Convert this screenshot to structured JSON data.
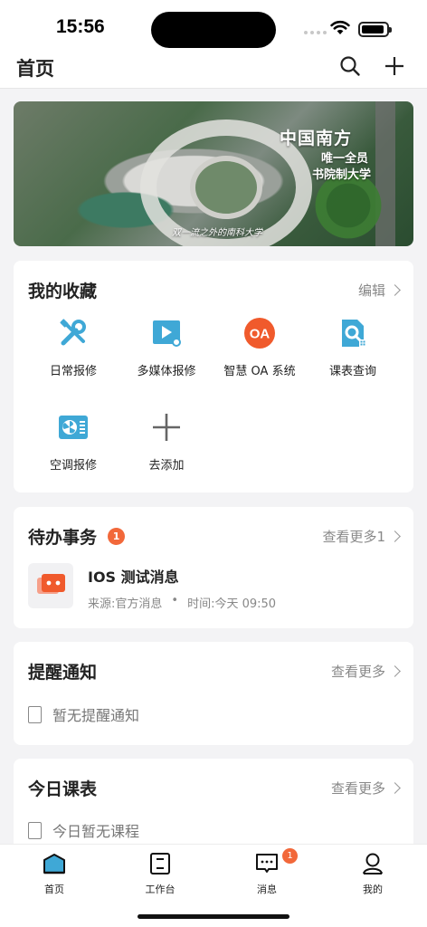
{
  "status": {
    "time": "15:56"
  },
  "nav": {
    "title": "首页"
  },
  "banner": {
    "line1": "中国南方",
    "line2": "唯一全员",
    "line3": "书院制大学",
    "caption": "双一流之外的南科大学"
  },
  "favorites": {
    "title": "我的收藏",
    "edit_label": "编辑",
    "items": [
      {
        "label": "日常报修",
        "icon": "tools-icon"
      },
      {
        "label": "多媒体报修",
        "icon": "media-icon"
      },
      {
        "label": "智慧 OA 系统",
        "icon": "oa-icon",
        "icon_text": "OA"
      },
      {
        "label": "课表查询",
        "icon": "timetable-search-icon"
      },
      {
        "label": "空调报修",
        "icon": "air-conditioner-icon"
      },
      {
        "label": "去添加",
        "icon": "plus-icon"
      }
    ]
  },
  "todo": {
    "title": "待办事务",
    "badge": "1",
    "more_label": "查看更多1",
    "item": {
      "title": "IOS 测试消息",
      "source": "来源:官方消息",
      "dot": "•",
      "time": "时间:今天 09:50"
    }
  },
  "reminders": {
    "title": "提醒通知",
    "more_label": "查看更多",
    "empty_text": "暂无提醒通知"
  },
  "schedule": {
    "title": "今日课表",
    "more_label": "查看更多",
    "empty_text": "今日暂无课程"
  },
  "tabbar": {
    "items": [
      {
        "label": "首页"
      },
      {
        "label": "工作台"
      },
      {
        "label": "消息",
        "badge": "1"
      },
      {
        "label": "我的"
      }
    ]
  },
  "colors": {
    "accent": "#3fa8d6",
    "badge": "#f2683a",
    "oa": "#f05a2c"
  }
}
